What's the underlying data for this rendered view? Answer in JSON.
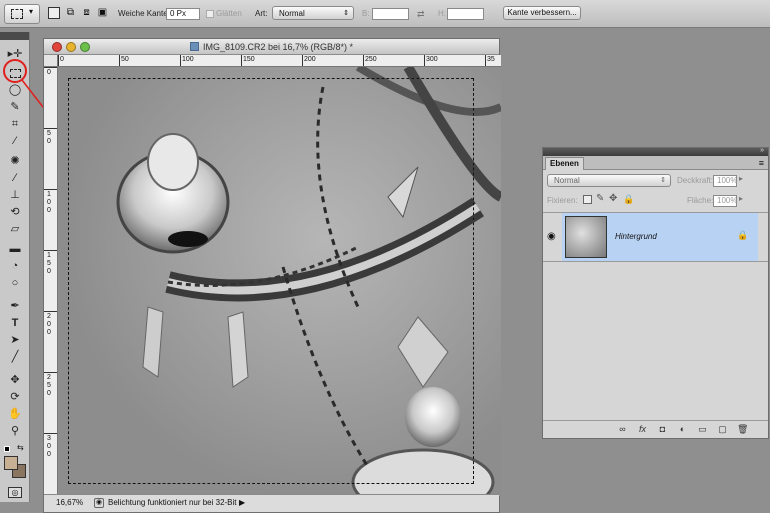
{
  "options_bar": {
    "feather_label": "Weiche Kante:",
    "feather_value": "0 Px",
    "antialias_label": "Glätten",
    "style_label": "Art:",
    "style_value": "Normal",
    "width_label": "B:",
    "height_label": "H:",
    "refine_edge_label": "Kante verbessern..."
  },
  "document": {
    "title": "IMG_8109.CR2 bei 16,7% (RGB/8*) *",
    "ruler_top_ticks": [
      "0",
      "50",
      "100",
      "150",
      "200",
      "250",
      "300",
      "35"
    ],
    "ruler_left_ticks": [
      "0",
      "5\n0",
      "1\n0\n0",
      "1\n5\n0",
      "2\n0\n0",
      "2\n5\n0",
      "3\n0\n0",
      "3"
    ],
    "zoom": "16,67%",
    "status_message": "Belichtung funktioniert nur bei 32-Bit"
  },
  "layers_panel": {
    "tab_label": "Ebenen",
    "blend_mode": "Normal",
    "opacity_label": "Deckkraft:",
    "opacity_value": "100%",
    "lock_label": "Fixieren:",
    "fill_label": "Fläche:",
    "fill_value": "100%",
    "layers": [
      {
        "name": "Hintergrund",
        "locked": true,
        "visible": true,
        "selected": true
      }
    ]
  },
  "colors": {
    "foreground": "#c8b094",
    "background": "#8a7560",
    "annotation": "#e0201c",
    "selection_highlight": "#b8d2f4"
  }
}
